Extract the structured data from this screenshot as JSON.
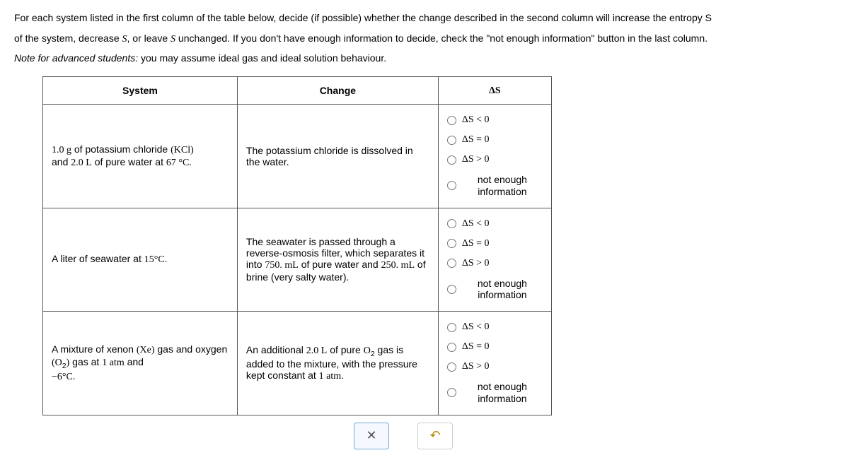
{
  "instructions_l1": "For each system listed in the first column of the table below, decide (if possible) whether the change described in the second column will increase the entropy S",
  "instructions_l2a": "of the system, decrease ",
  "instructions_l2b": ", or leave ",
  "instructions_l2c": " unchanged. If you don't have enough information to decide, check the \"not enough information\" button in the last column.",
  "note_prefix": "Note for advanced students:",
  "note_body": " you may assume ideal gas and ideal solution behaviour.",
  "headers": {
    "system": "System",
    "change": "Change",
    "ds": "ΔS"
  },
  "options": {
    "lt": "ΔS < 0",
    "eq": "ΔS = 0",
    "gt": "ΔS > 0",
    "nei": "not enough information"
  },
  "rows": [
    {
      "sys_a": "1.0 g",
      "sys_b": " of potassium chloride ",
      "sys_c": "(KCl)",
      "sys_d": "and ",
      "sys_e": "2.0 L",
      "sys_f": " of pure water at ",
      "sys_g": "67 °C.",
      "chg": "The potassium chloride is dissolved in the water."
    },
    {
      "sys_a": "A liter of seawater at ",
      "sys_b": "15°C.",
      "chg_a": "The seawater is passed through a reverse-osmosis filter, which separates it into ",
      "chg_b": "750. mL",
      "chg_c": " of pure water and ",
      "chg_d": "250. mL",
      "chg_e": " of brine (very salty water)."
    },
    {
      "sys_a": "A mixture of xenon ",
      "sys_b": "(Xe)",
      "sys_c": " gas and oxygen ",
      "sys_d": "(O",
      "sys_e": ")",
      "sys_f": " gas at ",
      "sys_g": "1 atm",
      "sys_h": " and ",
      "sys_i": "−6°C.",
      "chg_a": "An additional ",
      "chg_b": "2.0 L",
      "chg_c": " of pure ",
      "chg_d": "O",
      "chg_e": " gas is added to the mixture, with the pressure kept constant at ",
      "chg_f": "1 atm."
    }
  ],
  "s_var": "S"
}
